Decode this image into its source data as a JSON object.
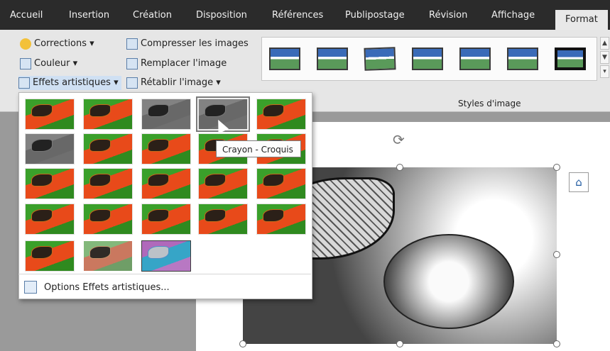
{
  "tabs": [
    "Accueil",
    "Insertion",
    "Création",
    "Disposition",
    "Références",
    "Publipostage",
    "Révision",
    "Affichage",
    "Format"
  ],
  "ribbon": {
    "corrections": "Corrections ▾",
    "couleur": "Couleur ▾",
    "effets": "Effets artistiques ▾",
    "compresser": "Compresser les images",
    "remplacer": "Remplacer l'image",
    "retablir": "Rétablir l'image  ▾",
    "styles_label": "Styles d'image"
  },
  "tooltip": "Crayon - Croquis",
  "gallery": {
    "options_label": "Options Effets artistiques..."
  },
  "icons": {
    "corrections": "sun-icon",
    "couleur": "color-icon",
    "effets": "artistic-effects-icon",
    "compresser": "compress-icon",
    "remplacer": "change-picture-icon",
    "retablir": "reset-picture-icon",
    "options": "brush-icon"
  },
  "colors": {
    "tabbar": "#2b2b2b",
    "ribbon": "#e6e6e6",
    "accent": "#1f5aa0"
  }
}
